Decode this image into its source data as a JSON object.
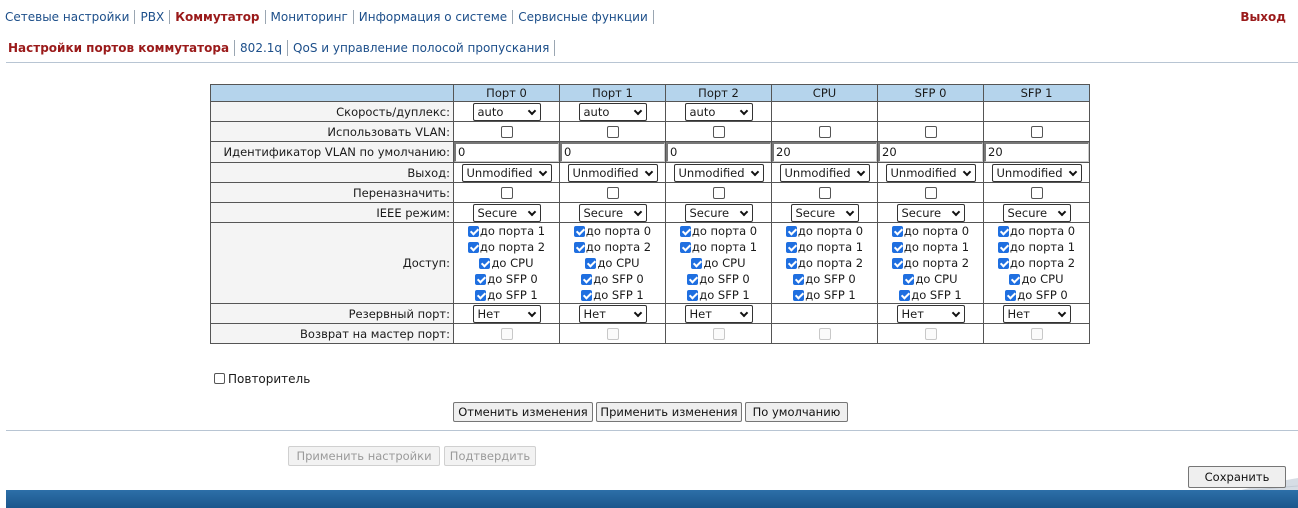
{
  "topnav": {
    "items": [
      "Сетевые настройки",
      "PBX",
      "Коммутатор",
      "Мониторинг",
      "Информация о системе",
      "Сервисные функции"
    ],
    "active_index": 2,
    "logout": "Выход"
  },
  "subnav": {
    "items": [
      "Настройки портов коммутатора",
      "802.1q",
      "QoS и управление полосой пропускания"
    ],
    "active_index": 0
  },
  "table": {
    "columns": [
      "Порт 0",
      "Порт 1",
      "Порт 2",
      "CPU",
      "SFP 0",
      "SFP 1"
    ],
    "rows": {
      "speed": "Скорость/дуплекс:",
      "vlan": "Использовать VLAN:",
      "vlan_id": "Идентификатор VLAN по умолчанию:",
      "egress": "Выход:",
      "reassign": "Переназначить:",
      "ieee": "IEEE режим:",
      "access": "Доступ:",
      "backup": "Резервный порт:",
      "revert": "Возврат на мастер порт:"
    },
    "speed_values": [
      "auto",
      "auto",
      "auto"
    ],
    "vlan_id_values": [
      "0",
      "0",
      "0",
      "20",
      "20",
      "20"
    ],
    "egress_values": [
      "Unmodified",
      "Unmodified",
      "Unmodified",
      "Unmodified",
      "Unmodified",
      "Unmodified"
    ],
    "ieee_values": [
      "Secure",
      "Secure",
      "Secure",
      "Secure",
      "Secure",
      "Secure"
    ],
    "access": [
      [
        "до порта 1",
        "до порта 2",
        "до CPU",
        "до SFP 0",
        "до SFP 1"
      ],
      [
        "до порта 0",
        "до порта 2",
        "до CPU",
        "до SFP 0",
        "до SFP 1"
      ],
      [
        "до порта 0",
        "до порта 1",
        "до CPU",
        "до SFP 0",
        "до SFP 1"
      ],
      [
        "до порта 0",
        "до порта 1",
        "до порта 2",
        "до SFP 0",
        "до SFP 1"
      ],
      [
        "до порта 0",
        "до порта 1",
        "до порта 2",
        "до CPU",
        "до SFP 1"
      ],
      [
        "до порта 0",
        "до порта 1",
        "до порта 2",
        "до CPU",
        "до SFP 0"
      ]
    ],
    "backup_values": [
      "Нет",
      "Нет",
      "Нет",
      "",
      "Нет",
      "Нет"
    ]
  },
  "repeater_label": "Повторитель",
  "buttons": {
    "cancel": "Отменить изменения",
    "apply": "Применить изменения",
    "default": "По умолчанию",
    "apply_settings": "Применить настройки",
    "confirm": "Подтвердить",
    "save": "Сохранить"
  },
  "colors": {
    "accent_red": "#9a1a1a",
    "link_blue": "#1d4f8a",
    "header_blue": "#b5d4ec",
    "checkbox_blue": "#1f6fe0",
    "footer_blue": "#1b568c"
  }
}
